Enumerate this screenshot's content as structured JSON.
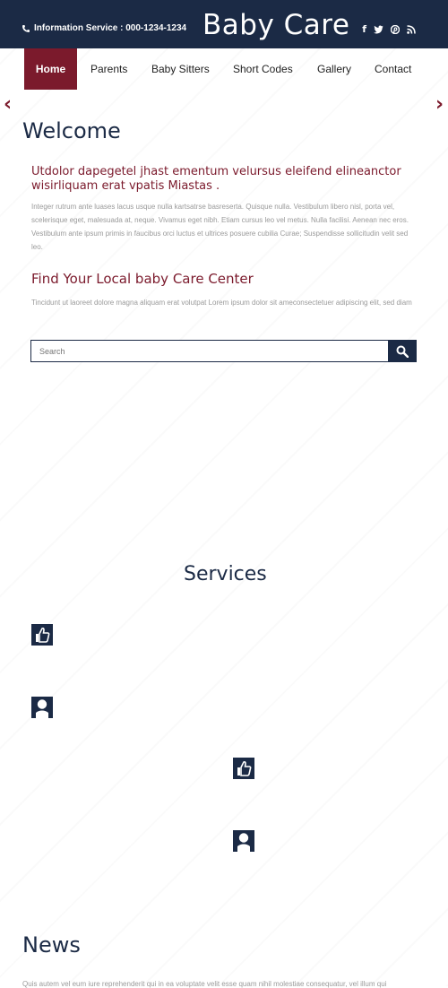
{
  "header": {
    "info_label": "Information Service : 000-1234-1234",
    "brand": "Baby Care",
    "social": [
      "f",
      "t",
      "p",
      "rss"
    ]
  },
  "nav": {
    "items": [
      "Home",
      "Parents",
      "Baby Sitters",
      "Short Codes",
      "Gallery",
      "Contact"
    ],
    "active": "Home"
  },
  "slider": {
    "prev": "‹",
    "next": "›"
  },
  "welcome": {
    "title": "Welcome",
    "lead": "Utdolor dapegetel jhast ementum velursus eleifend elineanctor wisirliquam erat vpatis Miastas .",
    "body": "Integer rutrum ante luases lacus usque nulla kartsatrse basreserta. Quisque nulla. Vestibulum libero nisl, porta vel, scelerisque eget, malesuada at, neque. Vivamus eget nibh. Etiam cursus leo vel metus. Nulla facilisi. Aenean nec eros. Vestibulum ante ipsum primis in faucibus orci luctus et ultrices posuere cubilia Curae; Suspendisse sollicitudin velit sed leo."
  },
  "finder": {
    "title": "Find Your Local baby Care Center",
    "body": "Tincidunt ut laoreet dolore magna aliquam erat volutpat Lorem ipsum dolor sit ameconsectetuer adipiscing elit, sed diam",
    "search_placeholder": "Search"
  },
  "services": {
    "title": "Services",
    "icons": [
      "thumbs-up-icon",
      "user-icon",
      "thumbs-up-icon",
      "user-icon"
    ]
  },
  "news": {
    "title": "News",
    "body": "Quis autem vel eum iure reprehenderit qui in ea voluptate velit esse quam nihil molestiae consequatur, vel illum qui"
  },
  "colors": {
    "navy": "#1b2a45",
    "maroon": "#7b1a2c"
  }
}
